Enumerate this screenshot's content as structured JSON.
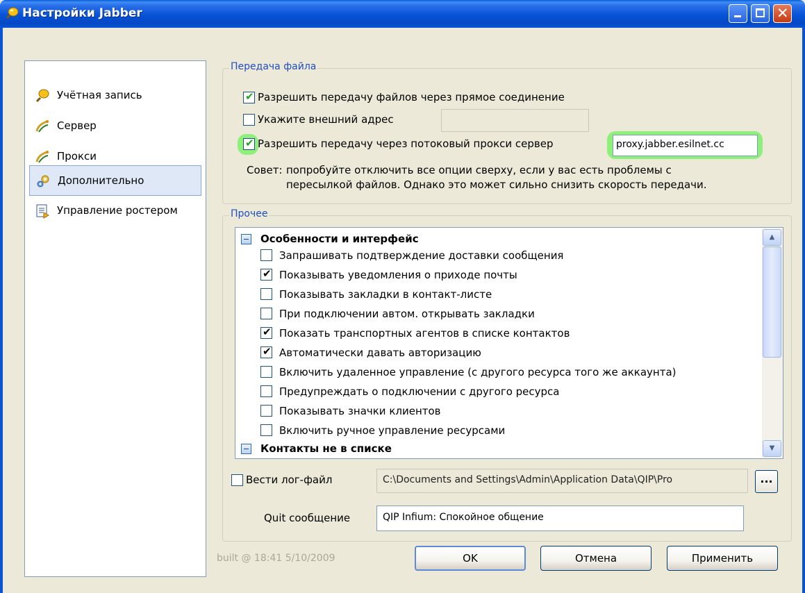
{
  "window": {
    "title": "Настройки Jabber"
  },
  "sidebar": {
    "items": [
      {
        "label": "Учётная запись",
        "icon": "account-bulb-icon",
        "selected": false
      },
      {
        "label": "Сервер",
        "icon": "server-satellite-icon",
        "selected": false
      },
      {
        "label": "Прокси",
        "icon": "proxy-satellite-icon",
        "selected": false
      },
      {
        "label": "Дополнительно",
        "icon": "advanced-gears-icon",
        "selected": true
      },
      {
        "label": "Управление ростером",
        "icon": "roster-list-icon",
        "selected": false
      }
    ]
  },
  "file_transfer": {
    "group_title": "Передача файла",
    "direct_connection": {
      "label": "Разрешить передачу файлов через прямое соединение",
      "checked": true
    },
    "external_address": {
      "label": "Укажите внешний адрес",
      "checked": false,
      "value": ""
    },
    "stream_proxy": {
      "label": "Разрешить передачу через потоковый прокси сервер",
      "checked": true,
      "value": "proxy.jabber.esilnet.cc"
    },
    "tip_label": "Совет:",
    "tip_line1": "попробуйте отключить все опции сверху, если у вас есть проблемы с",
    "tip_line2": "пересылкой файлов. Однако это может сильно снизить скорость передачи."
  },
  "misc": {
    "group_title": "Прочее",
    "tree": [
      {
        "type": "group",
        "label": "Особенности и интерфейс"
      },
      {
        "type": "option",
        "label": "Запрашивать подтверждение доставки сообщения",
        "checked": false
      },
      {
        "type": "option",
        "label": "Показывать уведомления о приходе почты",
        "checked": true
      },
      {
        "type": "option",
        "label": "Показывать закладки в контакт-листе",
        "checked": false
      },
      {
        "type": "option",
        "label": "При подключении автом. открывать закладки",
        "checked": false
      },
      {
        "type": "option",
        "label": "Показать транспортных агентов в списке контактов",
        "checked": true
      },
      {
        "type": "option",
        "label": "Автоматически давать авторизацию",
        "checked": true
      },
      {
        "type": "option",
        "label": "Включить удаленное управление (с другого ресурса того же аккаунта)",
        "checked": false
      },
      {
        "type": "option",
        "label": "Предупреждать о подключении с другого ресурса",
        "checked": false
      },
      {
        "type": "option",
        "label": "Показывать значки клиентов",
        "checked": false
      },
      {
        "type": "option",
        "label": "Включить ручное управление ресурсами",
        "checked": false
      },
      {
        "type": "group",
        "label": "Контакты не в списке"
      }
    ],
    "log_file": {
      "label": "Вести лог-файл",
      "checked": false,
      "path": "C:\\Documents and Settings\\Admin\\Application Data\\QIP\\Pro",
      "browse_label": "..."
    },
    "quit_message": {
      "label": "Quit сообщение",
      "value": "QIP Infium: Спокойное общение"
    }
  },
  "footer": {
    "build_info": "built @ 18:41 5/10/2009",
    "ok_label": "OK",
    "cancel_label": "Отмена",
    "apply_label": "Применить"
  },
  "colors": {
    "title_bar": "#0653d6",
    "group_title": "#1f4ec0",
    "highlight": "#8ef07a",
    "window_bg": "#ece9d8"
  }
}
